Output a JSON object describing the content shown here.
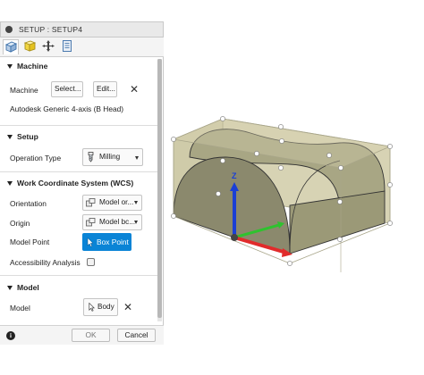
{
  "dialog": {
    "title": "SETUP : SETUP4"
  },
  "tabs": [
    {
      "icon": "setup-cube-icon"
    },
    {
      "icon": "stock-box-icon"
    },
    {
      "icon": "move-arrows-icon"
    },
    {
      "icon": "post-process-icon"
    }
  ],
  "machine": {
    "section_label": "Machine",
    "field_label": "Machine",
    "select_label": "Select...",
    "edit_label": "Edit...",
    "machine_name": "Autodesk Generic 4-axis (B Head)"
  },
  "setup": {
    "section_label": "Setup",
    "operation_type_label": "Operation Type",
    "operation_type_value": "Milling"
  },
  "wcs": {
    "section_label": "Work Coordinate System (WCS)",
    "orientation_label": "Orientation",
    "orientation_value": "Model or...",
    "origin_label": "Origin",
    "origin_value": "Model bc...",
    "model_point_label": "Model Point",
    "model_point_value": "Box Point",
    "accessibility_label": "Accessibility Analysis",
    "accessibility_checked": false
  },
  "model": {
    "section_label": "Model",
    "field_label": "Model",
    "value": "Body"
  },
  "footer": {
    "ok_label": "OK",
    "cancel_label": "Cancel"
  },
  "viewport": {
    "axis_z_label": "Z"
  },
  "colors": {
    "accent": "#0a84d6",
    "stock_fill": "#c9c6a4",
    "part_fill": "#8d8b6c"
  }
}
